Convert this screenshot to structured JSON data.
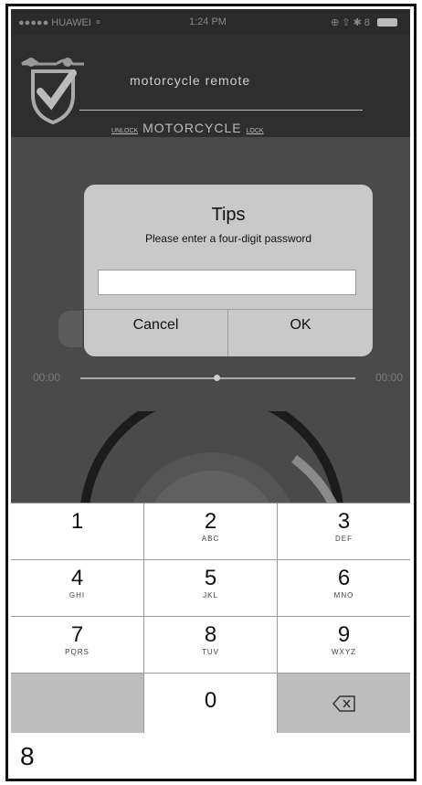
{
  "status_bar": {
    "carrier": "●●●●● HUAWEI ⚬",
    "time": "1:24 PM",
    "icons": "⊕ ⇧ ✱ 8"
  },
  "header": {
    "app_title": "motorcycle remote",
    "sub_unlock": "UNLOCK",
    "sub_title": "MOTORCYCLE",
    "sub_lock": "LOCK"
  },
  "timeline": {
    "left_time": "00:00",
    "right_time": "00:00"
  },
  "dialog": {
    "title": "Tips",
    "message": "Please enter a four-digit password",
    "input_value": "",
    "cancel_label": "Cancel",
    "ok_label": "OK"
  },
  "keypad": {
    "keys": [
      {
        "num": "1",
        "letters": ""
      },
      {
        "num": "2",
        "letters": "ABC"
      },
      {
        "num": "3",
        "letters": "DEF"
      },
      {
        "num": "4",
        "letters": "GHI"
      },
      {
        "num": "5",
        "letters": "JKL"
      },
      {
        "num": "6",
        "letters": "MNO"
      },
      {
        "num": "7",
        "letters": "PQRS"
      },
      {
        "num": "8",
        "letters": "TUV"
      },
      {
        "num": "9",
        "letters": "WXYZ"
      },
      {
        "num": "0",
        "letters": ""
      }
    ],
    "delete_icon": "backspace-icon"
  },
  "page_number": "8"
}
